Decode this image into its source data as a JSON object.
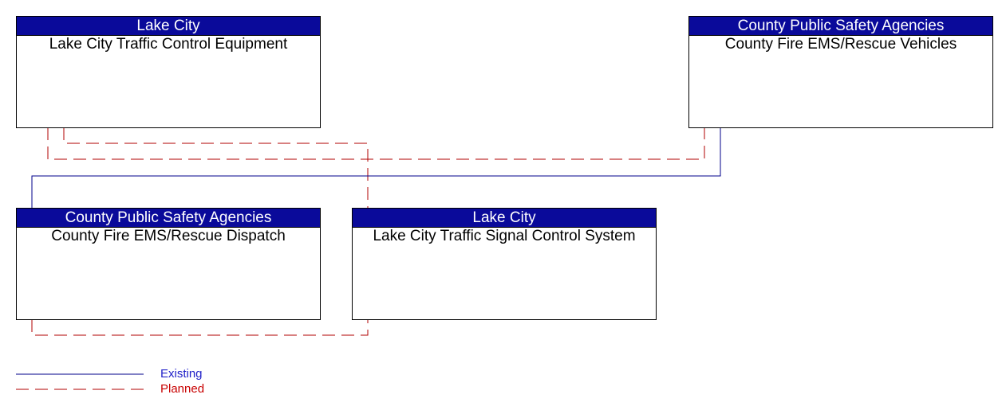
{
  "colors": {
    "existing": "#00008b",
    "planned": "#b00000",
    "header_bg": "#0a0a9a"
  },
  "nodes": [
    {
      "id": "lc-tce",
      "owner": "Lake City",
      "name": "Lake City Traffic Control Equipment"
    },
    {
      "id": "cf-vehicles",
      "owner": "County Public Safety Agencies",
      "name": "County Fire EMS/Rescue Vehicles"
    },
    {
      "id": "cf-dispatch",
      "owner": "County Public Safety Agencies",
      "name": "County Fire EMS/Rescue Dispatch"
    },
    {
      "id": "lc-tscs",
      "owner": "Lake City",
      "name": "Lake City Traffic Signal Control System"
    }
  ],
  "links": [
    {
      "from": "lc-tce",
      "to": "lc-tscs",
      "status": "planned"
    },
    {
      "from": "lc-tce",
      "to": "cf-vehicles",
      "status": "planned"
    },
    {
      "from": "cf-dispatch",
      "to": "cf-vehicles",
      "status": "existing"
    },
    {
      "from": "cf-dispatch",
      "to": "lc-tscs",
      "status": "planned"
    }
  ],
  "legend": {
    "existing": "Existing",
    "planned": "Planned"
  }
}
